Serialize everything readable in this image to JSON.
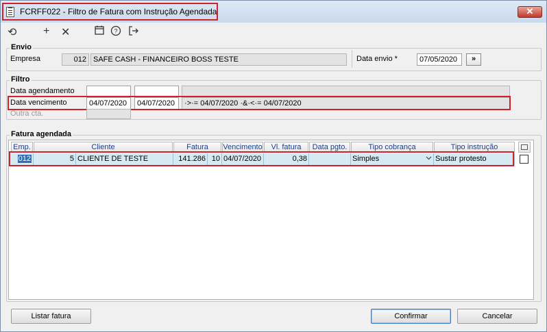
{
  "window": {
    "title": "FCRFF022 - Filtro de Fatura com Instrução Agendada",
    "close_label": "✕"
  },
  "toolbar": {
    "refresh_icon": "refresh-icon",
    "add_icon": "plus-icon",
    "delete_icon": "x-icon",
    "calendar_icon": "calendar-icon",
    "help_icon": "help-icon",
    "exit_icon": "exit-icon"
  },
  "envio": {
    "legend": "Envio",
    "empresa_label": "Empresa",
    "empresa_code": "012",
    "empresa_name": "SAFE CASH - FINANCEIRO BOSS TESTE",
    "data_envio_label": "Data envio *",
    "data_envio_value": "07/05/2020",
    "next_button": "»"
  },
  "filtro": {
    "legend": "Filtro",
    "data_agendamento_label": "Data agendamento",
    "data_agendamento_from": "",
    "data_agendamento_to": "",
    "data_agendamento_expr": "",
    "data_vencimento_label": "Data vencimento",
    "data_vencimento_from": "04/07/2020",
    "data_vencimento_to": "04/07/2020",
    "data_vencimento_expr": "·>·= 04/07/2020 ·&·<·= 04/07/2020",
    "outra_cta_label": "Outra cta.",
    "outra_cta_value": ""
  },
  "fatura_agendada": {
    "legend": "Fatura agendada",
    "columns": [
      "Emp.",
      "Cliente",
      "Fatura",
      "Vencimento",
      "Vl. fatura",
      "Data pgto.",
      "Tipo cobrança",
      "Tipo instrução"
    ],
    "rows": [
      {
        "emp": "012",
        "cliente_code": "5",
        "cliente_name": "CLIENTE DE TESTE",
        "fatura": "141.286",
        "parcela": "10",
        "vencimento": "04/07/2020",
        "vl_fatura": "0,38",
        "data_pgto": "",
        "tipo_cobranca": "Simples",
        "tipo_instrucao": "Sustar protesto"
      }
    ]
  },
  "buttons": {
    "listar": "Listar fatura",
    "confirmar": "Confirmar",
    "cancelar": "Cancelar"
  }
}
